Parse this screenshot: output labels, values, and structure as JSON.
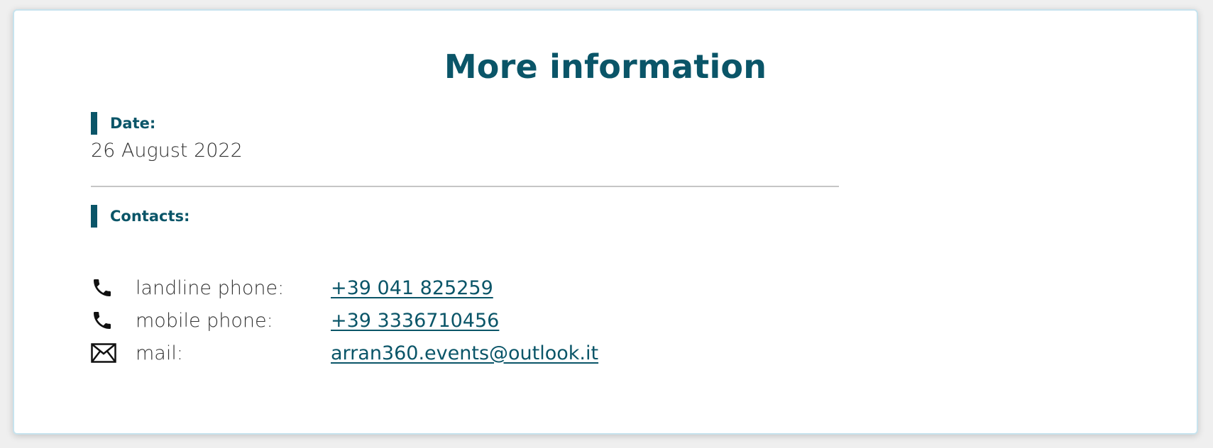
{
  "page": {
    "title": "More information"
  },
  "date_section": {
    "label": "Date:",
    "value": "26 August 2022"
  },
  "contacts_section": {
    "label": "Contacts:",
    "items": [
      {
        "icon": "phone-icon",
        "label": "landline phone:",
        "value": "+39 041 825259"
      },
      {
        "icon": "phone-icon",
        "label": "mobile phone:",
        "value": "+39 3336710456"
      },
      {
        "icon": "mail-icon",
        "label": "mail:",
        "value": "arran360.events@outlook.it"
      }
    ]
  },
  "colors": {
    "accent": "#0a5568",
    "text": "#333333",
    "divider": "#c6c6c6",
    "card_border": "#c7e3ee"
  }
}
